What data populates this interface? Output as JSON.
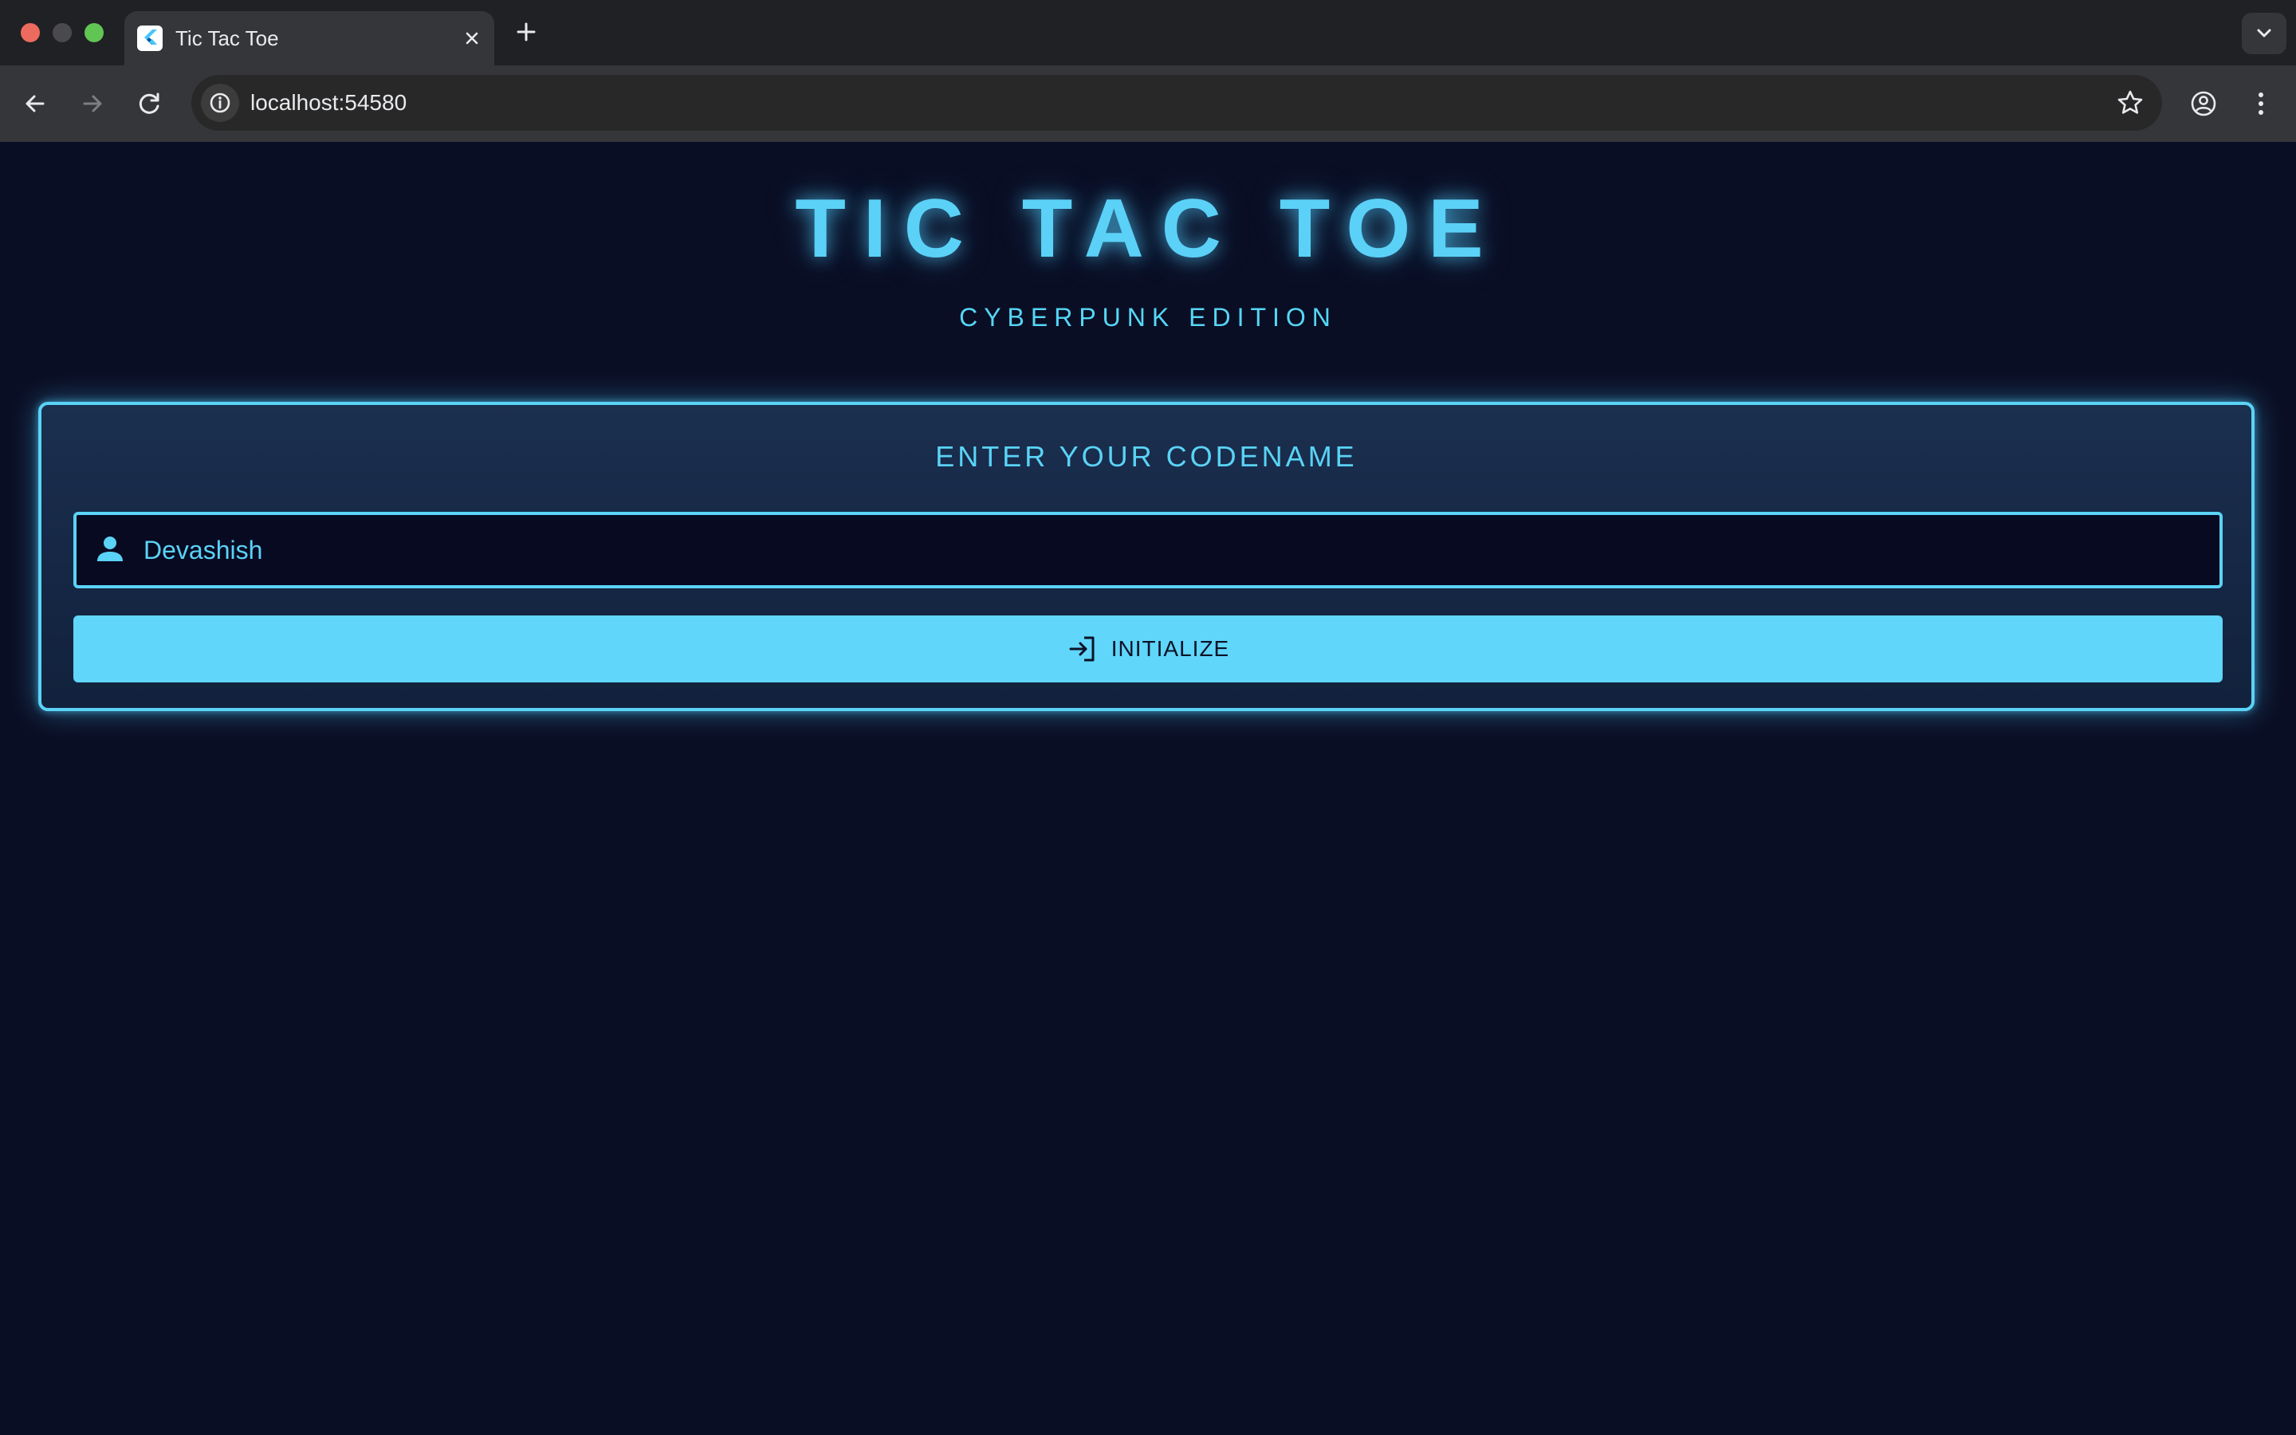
{
  "browser": {
    "tab": {
      "title": "Tic Tac Toe",
      "favicon": "flutter-logo-icon"
    },
    "address_bar": {
      "url": "localhost:54580"
    },
    "icons": {
      "back": "arrow-left-icon",
      "forward": "arrow-right-icon",
      "reload": "reload-icon",
      "info": "info-icon",
      "bookmark": "star-icon",
      "profile": "account-circle-icon",
      "menu": "more-vert-icon",
      "new_tab": "plus-icon",
      "tab_close": "close-icon",
      "tab_list": "chevron-down-icon"
    }
  },
  "app": {
    "title": "TIC TAC TOE",
    "subtitle": "CYBERPUNK EDITION",
    "card": {
      "heading": "ENTER YOUR CODENAME",
      "codename_value": "Devashish",
      "input_icon": "person-icon",
      "button_label": "INITIALIZE",
      "button_icon": "login-icon"
    }
  },
  "colors": {
    "page_background": "#0a0e24",
    "neon_cyan": "#5ad3f6",
    "button_fill": "#5fd6fa",
    "button_text": "#0c1226"
  }
}
